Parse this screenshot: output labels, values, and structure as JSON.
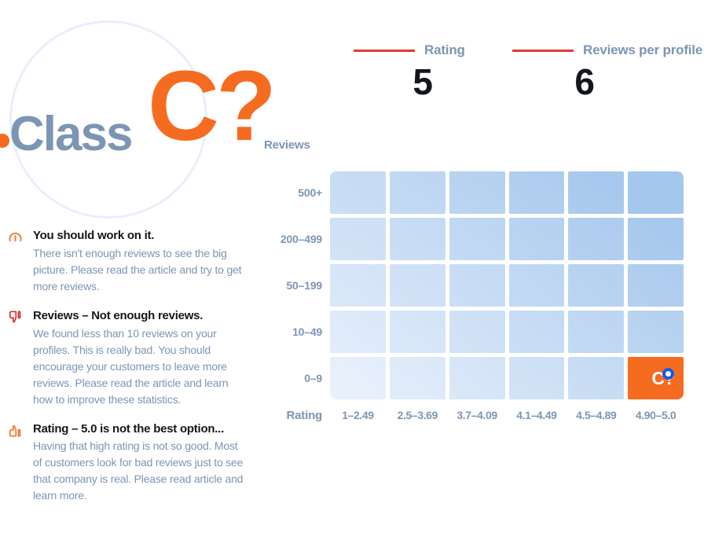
{
  "hero": {
    "label": "Class",
    "grade": "C?",
    "dot_color": "#f56c20",
    "text_color": "#7d95b4",
    "grade_color": "#f56c20",
    "circle_color": "#e8effb"
  },
  "stats": [
    {
      "name": "rating",
      "label": "Rating",
      "value": "5",
      "rule_color": "#e03b30"
    },
    {
      "name": "reviews-per-profile",
      "label": "Reviews per profile",
      "value": "6",
      "rule_color": "#e03b30"
    }
  ],
  "advice": [
    {
      "icon": "gauge-icon",
      "icon_color": "#f56c20",
      "title": "You should work on it.",
      "text": "There isn't enough reviews to see the big picture. Please read the article and try to get more reviews."
    },
    {
      "icon": "thumbs-down-icon",
      "icon_color": "#e02020",
      "title": "Reviews – Not enough reviews.",
      "text": "We found less than 10 reviews on your profiles. This is really bad. You should encourage your customers to leave more reviews. Please read the article and learn how to improve these statistics."
    },
    {
      "icon": "thumbs-up-icon",
      "icon_color": "#f56c20",
      "title": "Rating – 5.0 is not the best option...",
      "text": "Having that high rating is not so good. Most of customers look for bad reviews just to see that company is real. Please read article and learn more."
    }
  ],
  "chart_data": {
    "type": "heatmap",
    "title": "",
    "xlabel": "Rating",
    "ylabel": "Reviews",
    "categories_x": [
      "1–2.49",
      "2.5–3.69",
      "3.7–4.09",
      "4.1–4.49",
      "4.5–4.89",
      "4.90–5.0"
    ],
    "categories_y": [
      "500+",
      "200–499",
      "50–199",
      "10–49",
      "0–9"
    ],
    "grid": true,
    "legend": "none",
    "note": "Cell shade encodes density: lightest at bottom-left (low rating, few reviews), darkest at top-right (high rating, many reviews). Current company position is highlighted.",
    "values": [
      [
        5,
        6,
        7,
        8,
        9,
        10
      ],
      [
        4,
        5,
        6,
        7,
        8,
        9
      ],
      [
        3,
        4,
        5,
        6,
        7,
        8
      ],
      [
        2,
        3,
        4,
        5,
        6,
        7
      ],
      [
        1,
        2,
        3,
        4,
        5,
        6
      ]
    ],
    "highlight": {
      "row": 4,
      "col": 5,
      "row_label": "0–9",
      "col_label": "4.90–5.0",
      "grade": "C?",
      "color": "#f56c20",
      "marker_color": "#1358e8"
    }
  }
}
